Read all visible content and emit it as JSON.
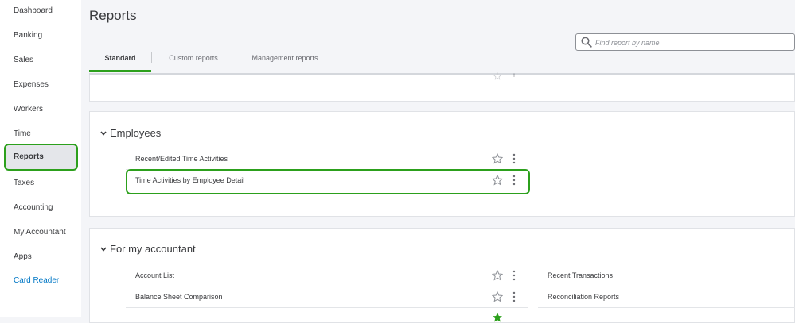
{
  "sidebar": {
    "items": [
      {
        "label": "Dashboard"
      },
      {
        "label": "Banking"
      },
      {
        "label": "Sales"
      },
      {
        "label": "Expenses"
      },
      {
        "label": "Workers"
      },
      {
        "label": "Time"
      },
      {
        "label": "Reports"
      },
      {
        "label": "Taxes"
      },
      {
        "label": "Accounting"
      },
      {
        "label": "My Accountant"
      },
      {
        "label": "Apps"
      },
      {
        "label": "Card Reader"
      }
    ],
    "active": "Reports"
  },
  "header": {
    "title": "Reports",
    "search_placeholder": "Find report by name"
  },
  "tabs": [
    {
      "label": "Standard"
    },
    {
      "label": "Custom reports"
    },
    {
      "label": "Management reports"
    }
  ],
  "sections": {
    "employees": {
      "title": "Employees",
      "rows": [
        {
          "label": "Recent/Edited Time Activities"
        },
        {
          "label": "Time Activities by Employee Detail"
        }
      ]
    },
    "accountant": {
      "title": "For my accountant",
      "left_rows": [
        {
          "label": "Account List"
        },
        {
          "label": "Balance Sheet Comparison"
        }
      ],
      "right_rows": [
        {
          "label": "Recent Transactions"
        },
        {
          "label": "Reconciliation Reports"
        }
      ]
    }
  },
  "colors": {
    "accent": "#2ca01c",
    "link": "#0077c5"
  }
}
